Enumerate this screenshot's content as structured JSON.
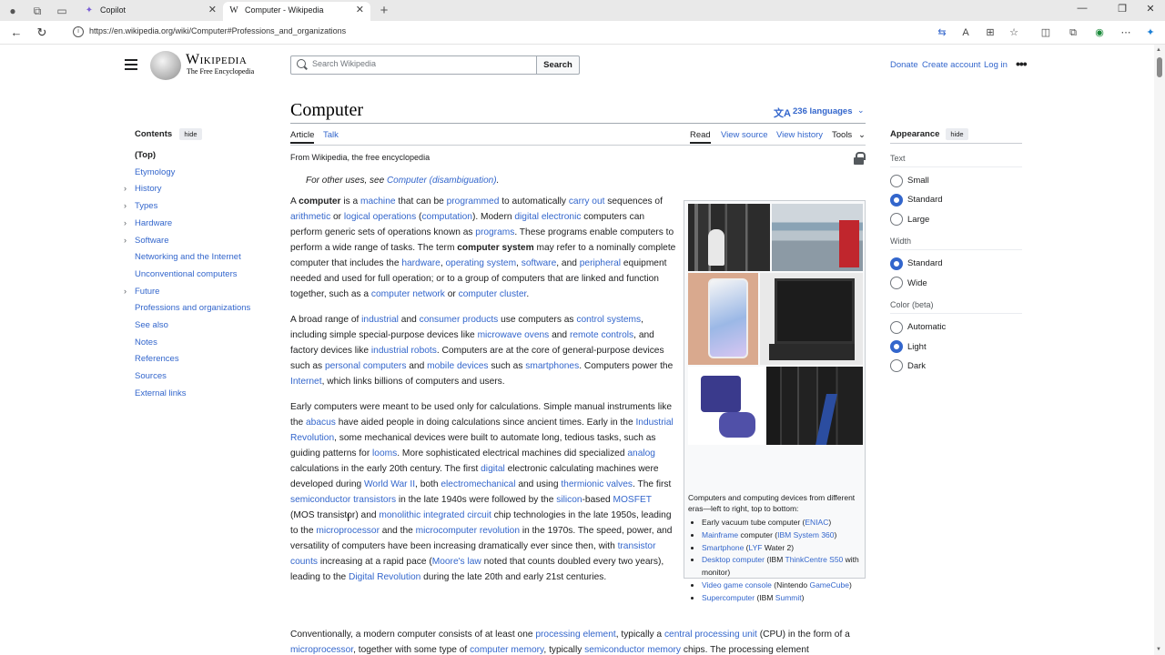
{
  "browser": {
    "tabs": [
      {
        "title": "Copilot",
        "icon": "copilot-icon"
      },
      {
        "title": "Computer - Wikipedia",
        "icon": "wikipedia-icon",
        "favicon": "W"
      }
    ],
    "url": "https://en.wikipedia.org/wiki/Computer#Professions_and_organizations"
  },
  "header": {
    "wordmark": "Wikipedia",
    "tagline": "The Free Encyclopedia",
    "search_placeholder": "Search Wikipedia",
    "search_button": "Search",
    "donate": "Donate",
    "create_account": "Create account",
    "log_in": "Log in"
  },
  "toc": {
    "title": "Contents",
    "hide": "hide",
    "items": [
      {
        "label": "(Top)",
        "expandable": false
      },
      {
        "label": "Etymology",
        "expandable": false
      },
      {
        "label": "History",
        "expandable": true
      },
      {
        "label": "Types",
        "expandable": true
      },
      {
        "label": "Hardware",
        "expandable": true
      },
      {
        "label": "Software",
        "expandable": true
      },
      {
        "label": "Networking and the Internet",
        "expandable": false
      },
      {
        "label": "Unconventional computers",
        "expandable": false
      },
      {
        "label": "Future",
        "expandable": true
      },
      {
        "label": "Professions and organizations",
        "expandable": false
      },
      {
        "label": "See also",
        "expandable": false
      },
      {
        "label": "Notes",
        "expandable": false
      },
      {
        "label": "References",
        "expandable": false
      },
      {
        "label": "Sources",
        "expandable": false
      },
      {
        "label": "External links",
        "expandable": false
      }
    ]
  },
  "article": {
    "title": "Computer",
    "languages": "236 languages",
    "tabs": {
      "article": "Article",
      "talk": "Talk",
      "read": "Read",
      "view_source": "View source",
      "view_history": "View history",
      "tools": "Tools"
    },
    "from": "From Wikipedia, the free encyclopedia",
    "hatnote_prefix": "For other uses, see ",
    "hatnote_link": "Computer (disambiguation)",
    "hatnote_suffix": "."
  },
  "infobox": {
    "caption": "Computers and computing devices from different eras—left to right, top to bottom:",
    "items": [
      "Early vacuum tube computer (ENIAC)",
      "Mainframe computer (IBM System 360)",
      "Smartphone (LYF Water 2)",
      "Desktop computer (IBM ThinkCentre S50 with monitor)",
      "Video game console (Nintendo GameCube)",
      "Supercomputer (IBM Summit)"
    ],
    "images": [
      "eniac",
      "mainframe",
      "smartphone",
      "desktop",
      "gamecube",
      "supercomputer"
    ]
  },
  "appearance": {
    "title": "Appearance",
    "hide": "hide",
    "text_label": "Text",
    "text_options": [
      {
        "label": "Small",
        "selected": false
      },
      {
        "label": "Standard",
        "selected": true
      },
      {
        "label": "Large",
        "selected": false
      }
    ],
    "width_label": "Width",
    "width_options": [
      {
        "label": "Standard",
        "selected": true
      },
      {
        "label": "Wide",
        "selected": false
      }
    ],
    "color_label": "Color (beta)",
    "color_options": [
      {
        "label": "Automatic",
        "selected": false
      },
      {
        "label": "Light",
        "selected": true
      },
      {
        "label": "Dark",
        "selected": false
      }
    ]
  },
  "colors": {
    "link": "#3366cc",
    "text": "#202122",
    "radio_on": "#3366cc"
  }
}
